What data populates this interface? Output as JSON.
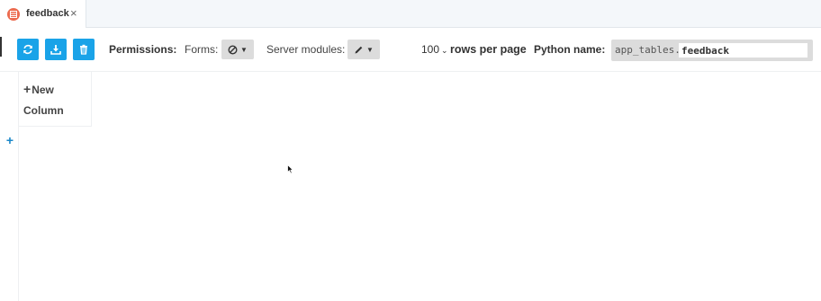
{
  "tab": {
    "label": "feedback",
    "icon": "table-icon",
    "close_glyph": "×"
  },
  "toolbar": {
    "refresh_icon": "refresh-icon",
    "download_icon": "download-icon",
    "delete_icon": "trash-icon",
    "permissions_label": "Permissions:",
    "forms_label": "Forms:",
    "forms_value_icon": "no-access-icon",
    "server_modules_label": "Server modules:",
    "server_modules_value_icon": "pencil-icon",
    "rows_value": "100",
    "rows_label": "rows per page",
    "python_name_label": "Python name:",
    "python_prefix": "app_tables.",
    "python_name_value": "feedback"
  },
  "grid": {
    "new_column_line1": "New",
    "new_column_line2": "Column",
    "add_row_glyph": "+"
  },
  "colors": {
    "accent": "#1aa3e8",
    "tab_icon": "#ec6b4f"
  }
}
